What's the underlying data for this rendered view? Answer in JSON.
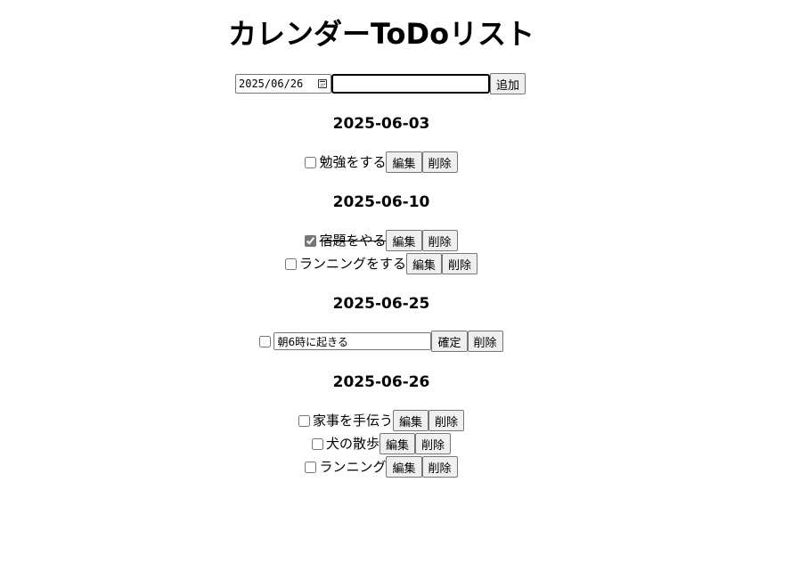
{
  "title": "カレンダーToDoリスト",
  "add_form": {
    "date_value": "2025/06/26",
    "text_value": "",
    "add_label": "追加"
  },
  "groups": [
    {
      "date": "2025-06-03",
      "items": [
        {
          "text": "勉強をする",
          "checked": false,
          "editing": false,
          "edit_label": "編集",
          "delete_label": "削除"
        }
      ]
    },
    {
      "date": "2025-06-10",
      "items": [
        {
          "text": "宿題をやる",
          "checked": true,
          "editing": false,
          "edit_label": "編集",
          "delete_label": "削除"
        },
        {
          "text": "ランニングをする",
          "checked": false,
          "editing": false,
          "edit_label": "編集",
          "delete_label": "削除"
        }
      ]
    },
    {
      "date": "2025-06-25",
      "items": [
        {
          "text": "朝6時に起きる",
          "checked": false,
          "editing": true,
          "confirm_label": "確定",
          "delete_label": "削除"
        }
      ]
    },
    {
      "date": "2025-06-26",
      "items": [
        {
          "text": "家事を手伝う",
          "checked": false,
          "editing": false,
          "edit_label": "編集",
          "delete_label": "削除"
        },
        {
          "text": "犬の散歩",
          "checked": false,
          "editing": false,
          "edit_label": "編集",
          "delete_label": "削除"
        },
        {
          "text": "ランニング",
          "checked": false,
          "editing": false,
          "edit_label": "編集",
          "delete_label": "削除"
        }
      ]
    }
  ]
}
